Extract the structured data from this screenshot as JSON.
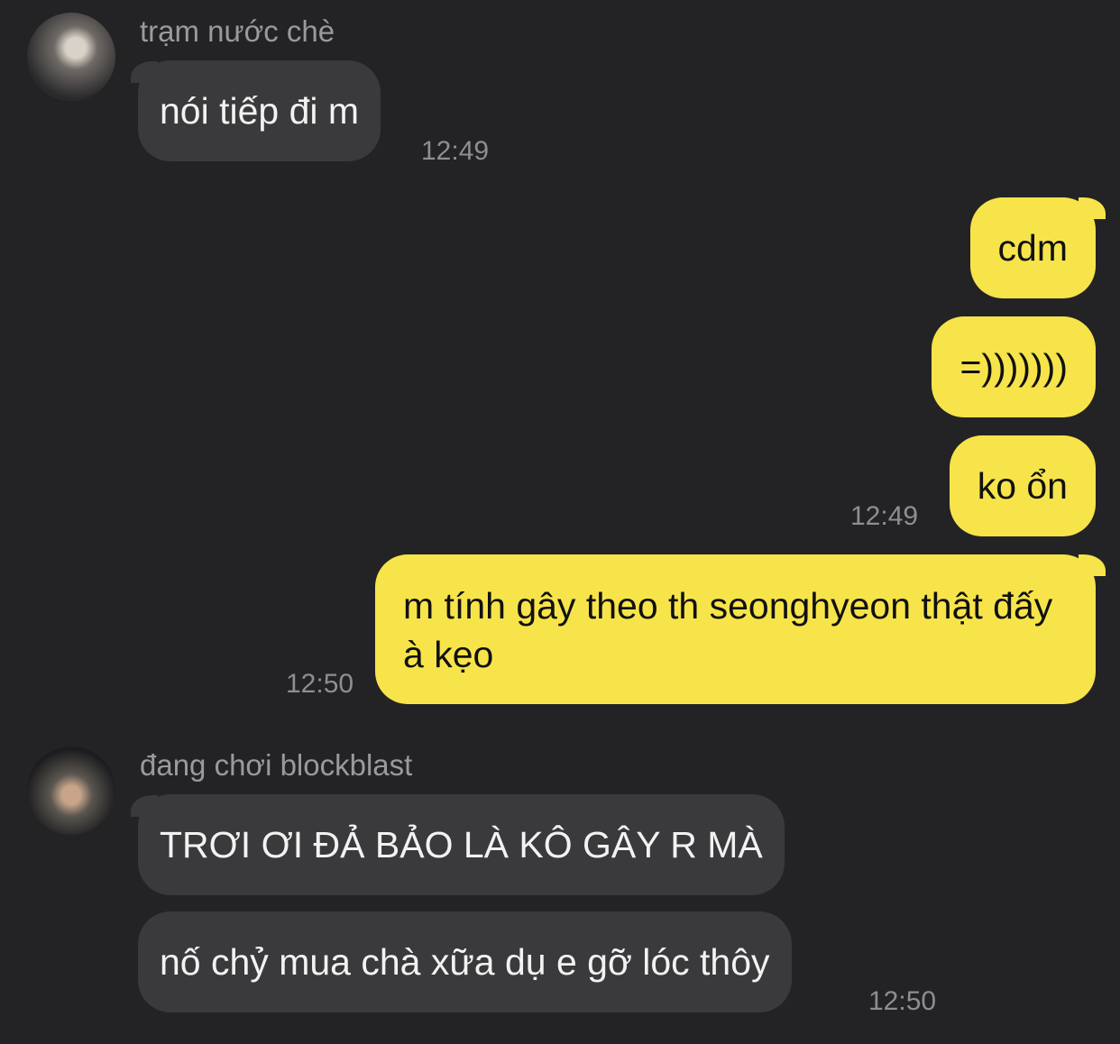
{
  "messages": {
    "group1": {
      "sender": "trạm nước chè",
      "avatar_icon": "user-avatar-photo",
      "bubbles": [
        "nói tiếp đi m"
      ],
      "time": "12:49"
    },
    "group2": {
      "bubbles": [
        "cdm",
        "=)))))))",
        "ko ổn"
      ],
      "time": "12:49"
    },
    "group3": {
      "bubbles": [
        "m tính gây theo th seonghyeon thật đấy à kẹo"
      ],
      "time": "12:50"
    },
    "group4": {
      "sender": "đang chơi blockblast",
      "avatar_icon": "user-avatar-photo",
      "bubbles": [
        "TRƠI ƠI ĐẢ BẢO LÀ KÔ GÂY R MÀ",
        "nố chỷ mua chà xữa dụ e gỡ lóc thôy"
      ],
      "time": "12:50"
    }
  },
  "colors": {
    "background": "#232325",
    "incoming_bubble": "#3a3a3c",
    "outgoing_bubble": "#f7e44a",
    "meta_text": "#9a9a9e"
  }
}
